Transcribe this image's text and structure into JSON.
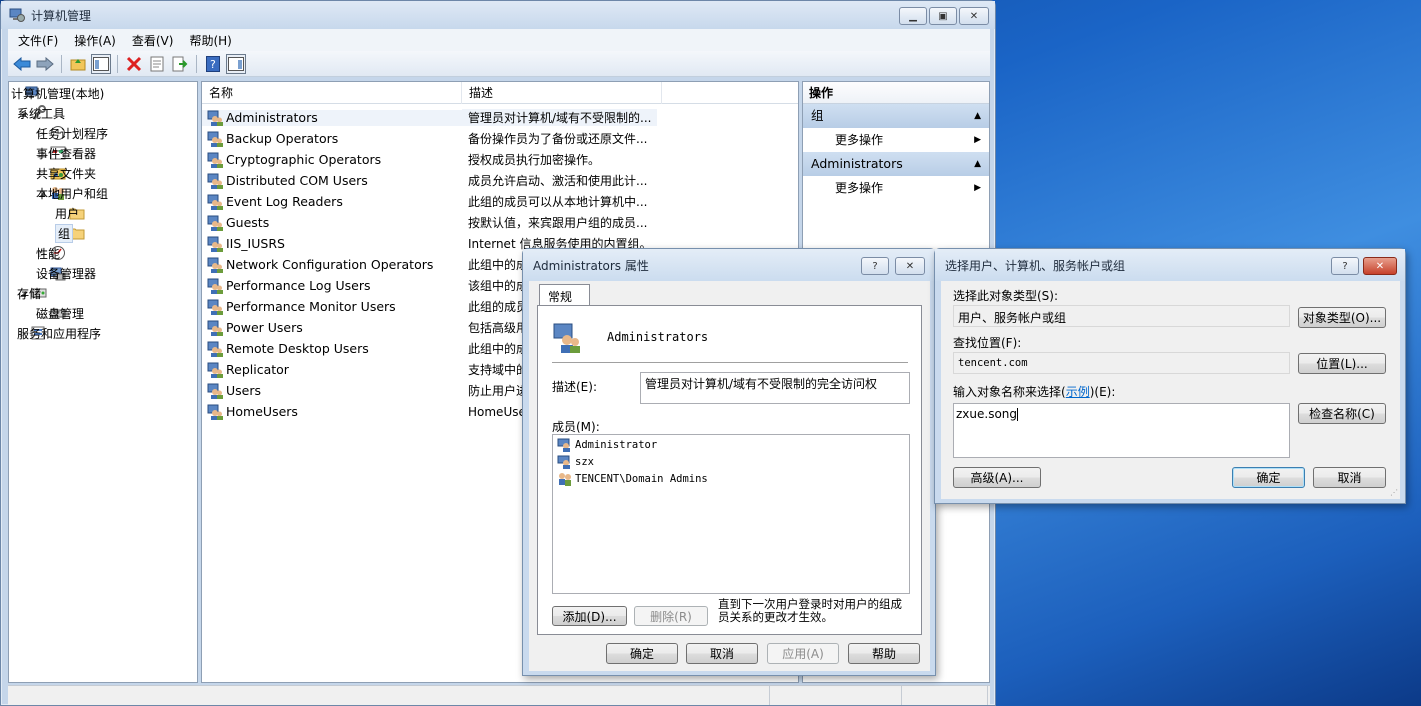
{
  "main_window": {
    "title": "计算机管理",
    "menu": [
      "文件(F)",
      "操作(A)",
      "查看(V)",
      "帮助(H)"
    ],
    "tree": [
      {
        "label": "计算机管理(本地)",
        "level": 0,
        "expander": ""
      },
      {
        "label": "系统工具",
        "level": 1,
        "expander": "◢"
      },
      {
        "label": "任务计划程序",
        "level": 2,
        "expander": "▷"
      },
      {
        "label": "事件查看器",
        "level": 2,
        "expander": "▷"
      },
      {
        "label": "共享文件夹",
        "level": 2,
        "expander": "▷"
      },
      {
        "label": "本地用户和组",
        "level": 2,
        "expander": "◢"
      },
      {
        "label": "用户",
        "level": 3,
        "expander": ""
      },
      {
        "label": "组",
        "level": 3,
        "expander": ""
      },
      {
        "label": "性能",
        "level": 2,
        "expander": "▷"
      },
      {
        "label": "设备管理器",
        "level": 2,
        "expander": ""
      },
      {
        "label": "存储",
        "level": 1,
        "expander": "◢"
      },
      {
        "label": "磁盘管理",
        "level": 2,
        "expander": ""
      },
      {
        "label": "服务和应用程序",
        "level": 1,
        "expander": "▷"
      }
    ],
    "list_columns": [
      "名称",
      "描述"
    ],
    "groups": [
      {
        "name": "Administrators",
        "desc": "管理员对计算机/域有不受限制的..."
      },
      {
        "name": "Backup Operators",
        "desc": "备份操作员为了备份或还原文件..."
      },
      {
        "name": "Cryptographic Operators",
        "desc": "授权成员执行加密操作。"
      },
      {
        "name": "Distributed COM Users",
        "desc": "成员允许启动、激活和使用此计..."
      },
      {
        "name": "Event Log Readers",
        "desc": "此组的成员可以从本地计算机中..."
      },
      {
        "name": "Guests",
        "desc": "按默认值，来宾跟用户组的成员..."
      },
      {
        "name": "IIS_IUSRS",
        "desc": "Internet 信息服务使用的内置组。"
      },
      {
        "name": "Network Configuration Operators",
        "desc": "此组中的成"
      },
      {
        "name": "Performance Log Users",
        "desc": "该组中的成"
      },
      {
        "name": "Performance Monitor Users",
        "desc": "此组的成员"
      },
      {
        "name": "Power Users",
        "desc": "包括高级用"
      },
      {
        "name": "Remote Desktop Users",
        "desc": "此组中的成"
      },
      {
        "name": "Replicator",
        "desc": "支持域中的"
      },
      {
        "name": "Users",
        "desc": "防止用户进"
      },
      {
        "name": "HomeUsers",
        "desc": "HomeUse"
      }
    ],
    "actions": {
      "header": "操作",
      "sections": [
        {
          "title": "组",
          "item": "更多操作"
        },
        {
          "title": "Administrators",
          "item": "更多操作"
        }
      ]
    }
  },
  "props_dialog": {
    "title": "Administrators 属性",
    "help_btn": "?",
    "tab": "常规",
    "group_name": "Administrators",
    "desc_label": "描述(E):",
    "desc_value": "管理员对计算机/域有不受限制的完全访问权",
    "members_label": "成员(M):",
    "members": [
      "Administrator",
      "szx",
      "TENCENT\\Domain Admins"
    ],
    "add_btn": "添加(D)...",
    "remove_btn": "删除(R)",
    "note": "直到下一次用户登录时对用户的组成员关系的更改才生效。",
    "ok": "确定",
    "cancel": "取消",
    "apply": "应用(A)",
    "help": "帮助"
  },
  "select_dialog": {
    "title": "选择用户、计算机、服务帐户或组",
    "help_btn": "?",
    "type_label": "选择此对象类型(S):",
    "type_value": "用户、服务帐户或组",
    "type_btn": "对象类型(O)...",
    "loc_label": "查找位置(F):",
    "loc_value": "tencent.com",
    "loc_btn": "位置(L)...",
    "input_label_pre": "输入对象名称来选择(",
    "input_label_link": "示例",
    "input_label_post": ")(E):",
    "input_value": "zxue.song",
    "check_btn": "检查名称(C)",
    "advanced_btn": "高级(A)...",
    "ok": "确定",
    "cancel": "取消"
  },
  "colors": {
    "link": "#0066cc",
    "selection": "#e5eef9"
  }
}
